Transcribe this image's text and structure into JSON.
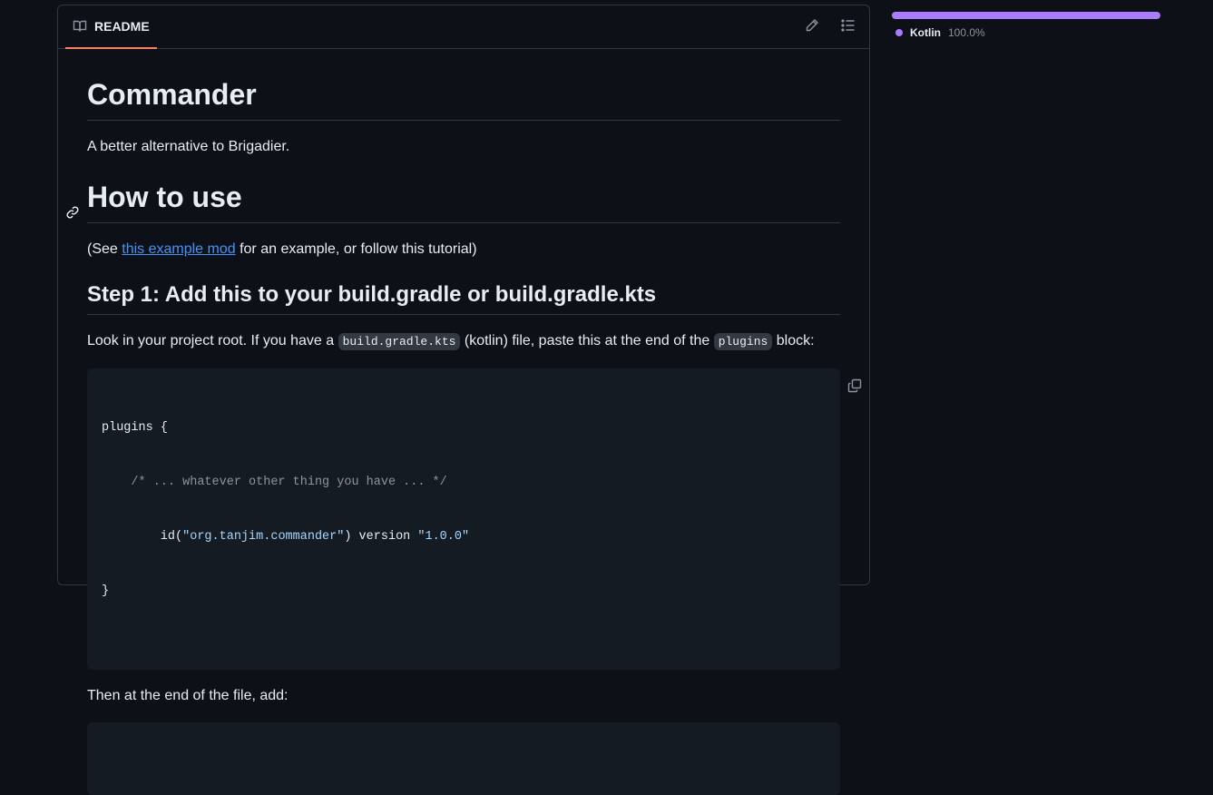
{
  "readme": {
    "tab_label": "README",
    "tab_icon": "book-icon",
    "edit_icon": "pencil-icon",
    "outline_icon": "list-unordered-icon"
  },
  "content": {
    "title": "Commander",
    "tagline": "A better alternative to Brigadier.",
    "how_to_use": "How to use",
    "see_prefix": "(See ",
    "see_link": "this example mod",
    "see_suffix": " for an example, or follow this tutorial)",
    "step1_heading": "Step 1: Add this to your build.gradle or build.gradle.kts",
    "look_prefix": "Look in your project root. If you have a ",
    "look_code1": "build.gradle.kts",
    "look_middle": " (kotlin) file, paste this at the end of the ",
    "look_code2": "plugins",
    "look_suffix": " block:",
    "code1": {
      "line1": "plugins {",
      "line2": "    /* ... whatever other thing you have ... */",
      "line3_pre": "        id(",
      "line3_str1": "\"org.tanjim.commander\"",
      "line3_mid": ") version ",
      "line3_str2": "\"1.0.0\"",
      "line4": "}"
    },
    "then_text": "Then at the end of the file, add:"
  },
  "languages": [
    {
      "name": "Kotlin",
      "percent": "100.0%",
      "color": "#A97BFF"
    }
  ],
  "colors": {
    "accent_tab": "#f78166",
    "link": "#4493f8",
    "kotlin": "#A97BFF"
  }
}
